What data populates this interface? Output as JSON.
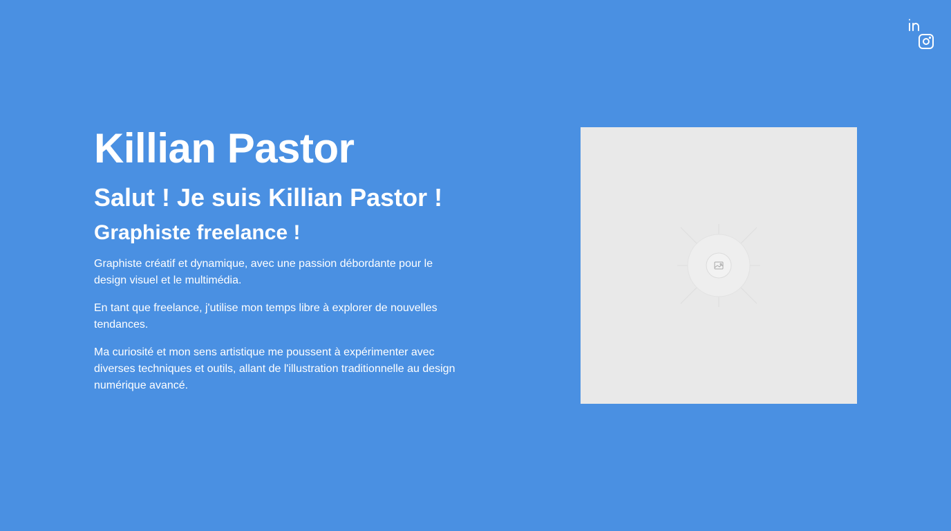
{
  "social": {
    "linkedin_icon": "linkedin-icon",
    "instagram_icon": "instagram-icon"
  },
  "hero": {
    "name": "Killian Pastor",
    "greeting": "Salut ! Je suis Killian Pastor !",
    "role": "Graphiste freelance !",
    "paragraphs": [
      "Graphiste créatif et dynamique, avec une passion débordante pour le design visuel et le multimédia.",
      "En tant que freelance, j'utilise mon temps libre à explorer de nouvelles tendances.",
      "Ma curiosité et mon sens artistique me poussent à expérimenter avec diverses techniques et outils, allant de l'illustration traditionnelle au design numérique avancé."
    ]
  },
  "image": {
    "icon": "image-placeholder-icon"
  },
  "colors": {
    "background": "#4a90e2",
    "text": "#ffffff",
    "placeholder": "#e9e9e9"
  }
}
